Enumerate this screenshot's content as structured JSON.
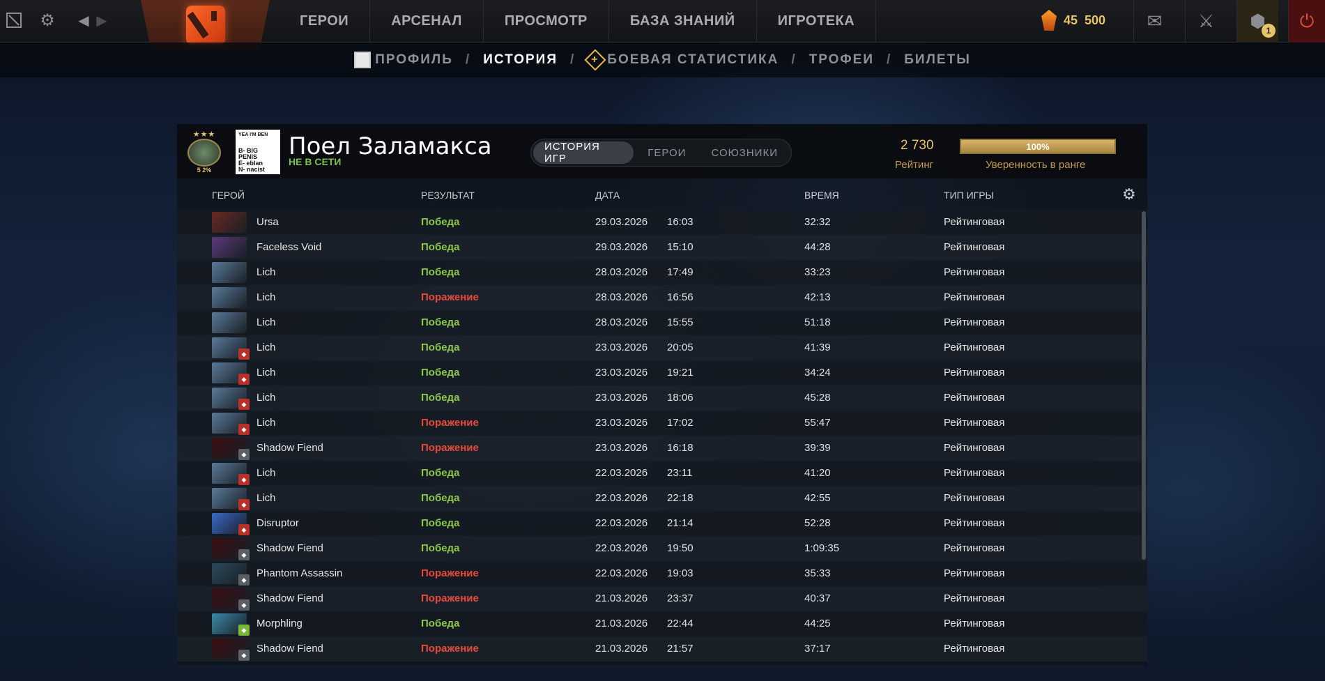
{
  "topbar": {
    "nav": [
      "ГЕРОИ",
      "АРСЕНАЛ",
      "ПРОСМОТР",
      "БАЗА ЗНАНИЙ",
      "ИГРОТЕКА"
    ],
    "currency_a": "45",
    "currency_b": "500",
    "notif_count": "1",
    "icons": [
      "dota-menu-icon",
      "settings-gear-icon",
      "back-arrow-icon",
      "forward-arrow-icon",
      "dota-logo-icon",
      "shard-icon",
      "mail-icon",
      "armory-icon",
      "battlepass-icon",
      "power-icon"
    ]
  },
  "subnav": {
    "profile": "ПРОФИЛЬ",
    "history": "ИСТОРИЯ",
    "stats": "БОЕВАЯ СТАТИСТИКА",
    "trophies": "ТРОФЕИ",
    "tickets": "БИЛЕТЫ",
    "separator": "/"
  },
  "player": {
    "name": "Поел Заламакса",
    "status": "НЕ В СЕТИ",
    "medal_stars": "★★★",
    "medal_num": "5 2%",
    "avatar_lines": [
      "YEA I'M BEN",
      "B- BIG PENIS",
      "E- eblan",
      "N- nacist"
    ]
  },
  "tabs": [
    "ИСТОРИЯ ИГР",
    "ГЕРОИ",
    "СОЮЗНИКИ"
  ],
  "rating": {
    "value": "2 730",
    "label": "Рейтинг",
    "confidence_pct": "100%",
    "confidence_label": "Уверенность в ранге"
  },
  "columns": [
    "ГЕРОЙ",
    "РЕЗУЛЬТАТ",
    "ДАТА",
    "ВРЕМЯ",
    "ТИП ИГРЫ"
  ],
  "matches": [
    {
      "hero": "Ursa",
      "result": "Победа",
      "win": true,
      "date": "29.03.2026",
      "time": "16:03",
      "duration": "32:32",
      "type": "Рейтинговая",
      "color": "#6a2a22",
      "badge": ""
    },
    {
      "hero": "Faceless Void",
      "result": "Победа",
      "win": true,
      "date": "29.03.2026",
      "time": "15:10",
      "duration": "44:28",
      "type": "Рейтинговая",
      "color": "#5a3a7a",
      "badge": ""
    },
    {
      "hero": "Lich",
      "result": "Победа",
      "win": true,
      "date": "28.03.2026",
      "time": "17:49",
      "duration": "33:23",
      "type": "Рейтинговая",
      "color": "#5a7a9a",
      "badge": ""
    },
    {
      "hero": "Lich",
      "result": "Поражение",
      "win": false,
      "date": "28.03.2026",
      "time": "16:56",
      "duration": "42:13",
      "type": "Рейтинговая",
      "color": "#5a7a9a",
      "badge": ""
    },
    {
      "hero": "Lich",
      "result": "Победа",
      "win": true,
      "date": "28.03.2026",
      "time": "15:55",
      "duration": "51:18",
      "type": "Рейтинговая",
      "color": "#5a7a9a",
      "badge": ""
    },
    {
      "hero": "Lich",
      "result": "Победа",
      "win": true,
      "date": "23.03.2026",
      "time": "20:05",
      "duration": "41:39",
      "type": "Рейтинговая",
      "color": "#5a7a9a",
      "badge": "red"
    },
    {
      "hero": "Lich",
      "result": "Победа",
      "win": true,
      "date": "23.03.2026",
      "time": "19:21",
      "duration": "34:24",
      "type": "Рейтинговая",
      "color": "#5a7a9a",
      "badge": "red"
    },
    {
      "hero": "Lich",
      "result": "Победа",
      "win": true,
      "date": "23.03.2026",
      "time": "18:06",
      "duration": "45:28",
      "type": "Рейтинговая",
      "color": "#5a7a9a",
      "badge": "red"
    },
    {
      "hero": "Lich",
      "result": "Поражение",
      "win": false,
      "date": "23.03.2026",
      "time": "17:02",
      "duration": "55:47",
      "type": "Рейтинговая",
      "color": "#5a7a9a",
      "badge": "red"
    },
    {
      "hero": "Shadow Fiend",
      "result": "Поражение",
      "win": false,
      "date": "23.03.2026",
      "time": "16:18",
      "duration": "39:39",
      "type": "Рейтинговая",
      "color": "#3a0e12",
      "badge": "grey"
    },
    {
      "hero": "Lich",
      "result": "Победа",
      "win": true,
      "date": "22.03.2026",
      "time": "23:11",
      "duration": "41:20",
      "type": "Рейтинговая",
      "color": "#5a7a9a",
      "badge": "red"
    },
    {
      "hero": "Lich",
      "result": "Победа",
      "win": true,
      "date": "22.03.2026",
      "time": "22:18",
      "duration": "42:55",
      "type": "Рейтинговая",
      "color": "#5a7a9a",
      "badge": "red"
    },
    {
      "hero": "Disruptor",
      "result": "Победа",
      "win": true,
      "date": "22.03.2026",
      "time": "21:14",
      "duration": "52:28",
      "type": "Рейтинговая",
      "color": "#3a6ac8",
      "badge": "red"
    },
    {
      "hero": "Shadow Fiend",
      "result": "Победа",
      "win": true,
      "date": "22.03.2026",
      "time": "19:50",
      "duration": "1:09:35",
      "type": "Рейтинговая",
      "color": "#3a0e12",
      "badge": "grey"
    },
    {
      "hero": "Phantom Assassin",
      "result": "Поражение",
      "win": false,
      "date": "22.03.2026",
      "time": "19:03",
      "duration": "35:33",
      "type": "Рейтинговая",
      "color": "#2a4a5a",
      "badge": "grey"
    },
    {
      "hero": "Shadow Fiend",
      "result": "Поражение",
      "win": false,
      "date": "21.03.2026",
      "time": "23:37",
      "duration": "40:37",
      "type": "Рейтинговая",
      "color": "#3a0e12",
      "badge": "grey"
    },
    {
      "hero": "Morphling",
      "result": "Победа",
      "win": true,
      "date": "21.03.2026",
      "time": "22:44",
      "duration": "44:25",
      "type": "Рейтинговая",
      "color": "#3a8aa8",
      "badge": "green"
    },
    {
      "hero": "Shadow Fiend",
      "result": "Поражение",
      "win": false,
      "date": "21.03.2026",
      "time": "21:57",
      "duration": "37:17",
      "type": "Рейтинговая",
      "color": "#3a0e12",
      "badge": "grey"
    }
  ],
  "colors": {
    "win": "#8cc84a",
    "loss": "#e84a3a",
    "gold": "#e8c46a"
  }
}
